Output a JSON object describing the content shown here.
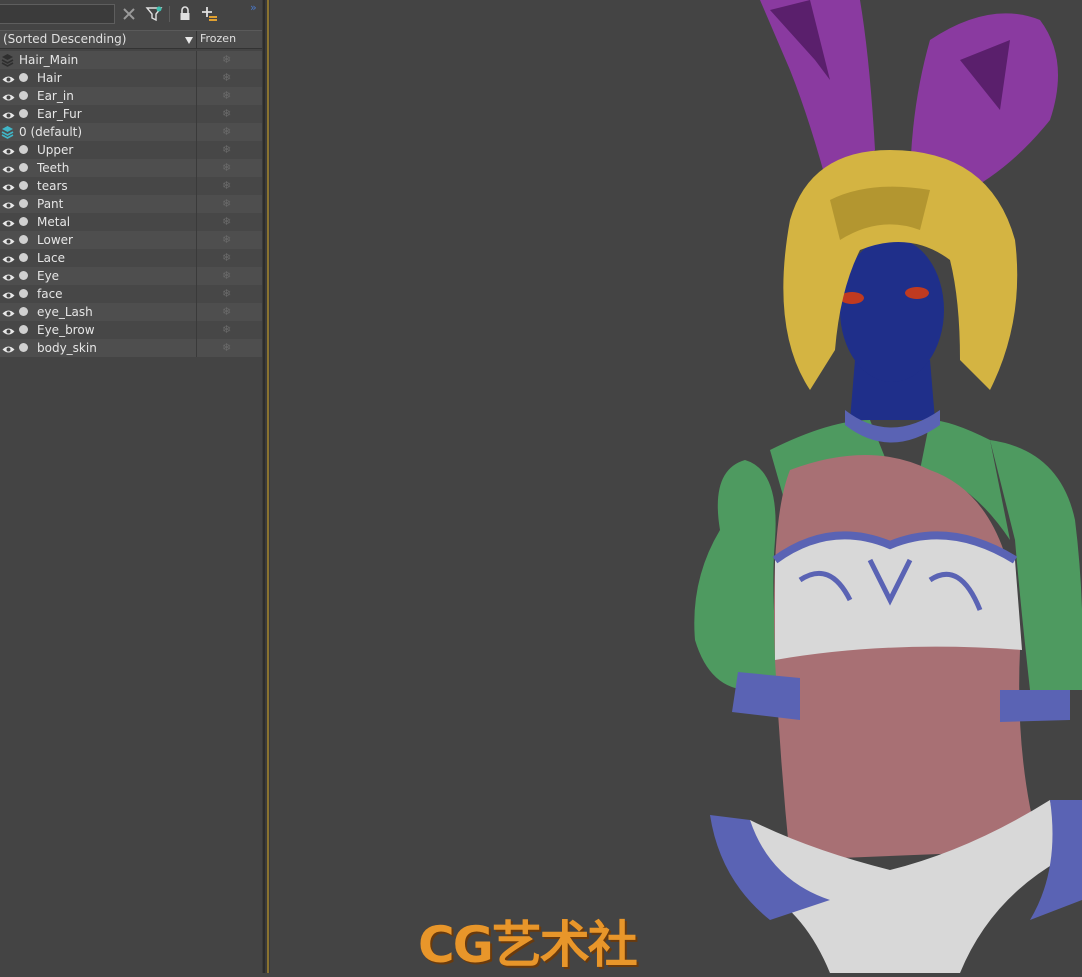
{
  "toolbar": {
    "search": {
      "value": "",
      "placeholder": ""
    },
    "icons": [
      "clear-icon",
      "filter-icon",
      "lock-icon",
      "add-layer-icon"
    ],
    "overflow": "»"
  },
  "header": {
    "sort_label": "(Sorted Descending)",
    "frozen_label": "Frozen"
  },
  "layers": [
    {
      "name": "Hair_Main",
      "type": "group",
      "visible": false
    },
    {
      "name": "Hair",
      "type": "layer",
      "visible": true
    },
    {
      "name": "Ear_in",
      "type": "layer",
      "visible": true
    },
    {
      "name": "Ear_Fur",
      "type": "layer",
      "visible": true
    },
    {
      "name": "0 (default)",
      "type": "default",
      "visible": false
    },
    {
      "name": "Upper",
      "type": "layer",
      "visible": true
    },
    {
      "name": "Teeth",
      "type": "layer",
      "visible": true
    },
    {
      "name": "tears",
      "type": "layer",
      "visible": true
    },
    {
      "name": "Pant",
      "type": "layer",
      "visible": true
    },
    {
      "name": "Metal",
      "type": "layer",
      "visible": true
    },
    {
      "name": "Lower",
      "type": "layer",
      "visible": true
    },
    {
      "name": "Lace",
      "type": "layer",
      "visible": true
    },
    {
      "name": "Eye",
      "type": "layer",
      "visible": true
    },
    {
      "name": "face",
      "type": "layer",
      "visible": true
    },
    {
      "name": "eye_Lash",
      "type": "layer",
      "visible": true
    },
    {
      "name": "Eye_brow",
      "type": "layer",
      "visible": true
    },
    {
      "name": "body_skin",
      "type": "layer",
      "visible": true
    }
  ],
  "frozen_icon": "❄",
  "watermark": "CG艺术社",
  "colors": {
    "panel_bg": "#444444",
    "viewport_bg": "#444444",
    "accent_gold": "#8a7330",
    "default_layer_icon": "#3fb6c8",
    "hair": "#d4b442",
    "ears": "#8a3aa0",
    "skin": "#a87074",
    "face": "#1f2f8a",
    "jacket": "#4e9a60",
    "trim": "#5a63b4",
    "cloth_white": "#d8d8d8"
  }
}
